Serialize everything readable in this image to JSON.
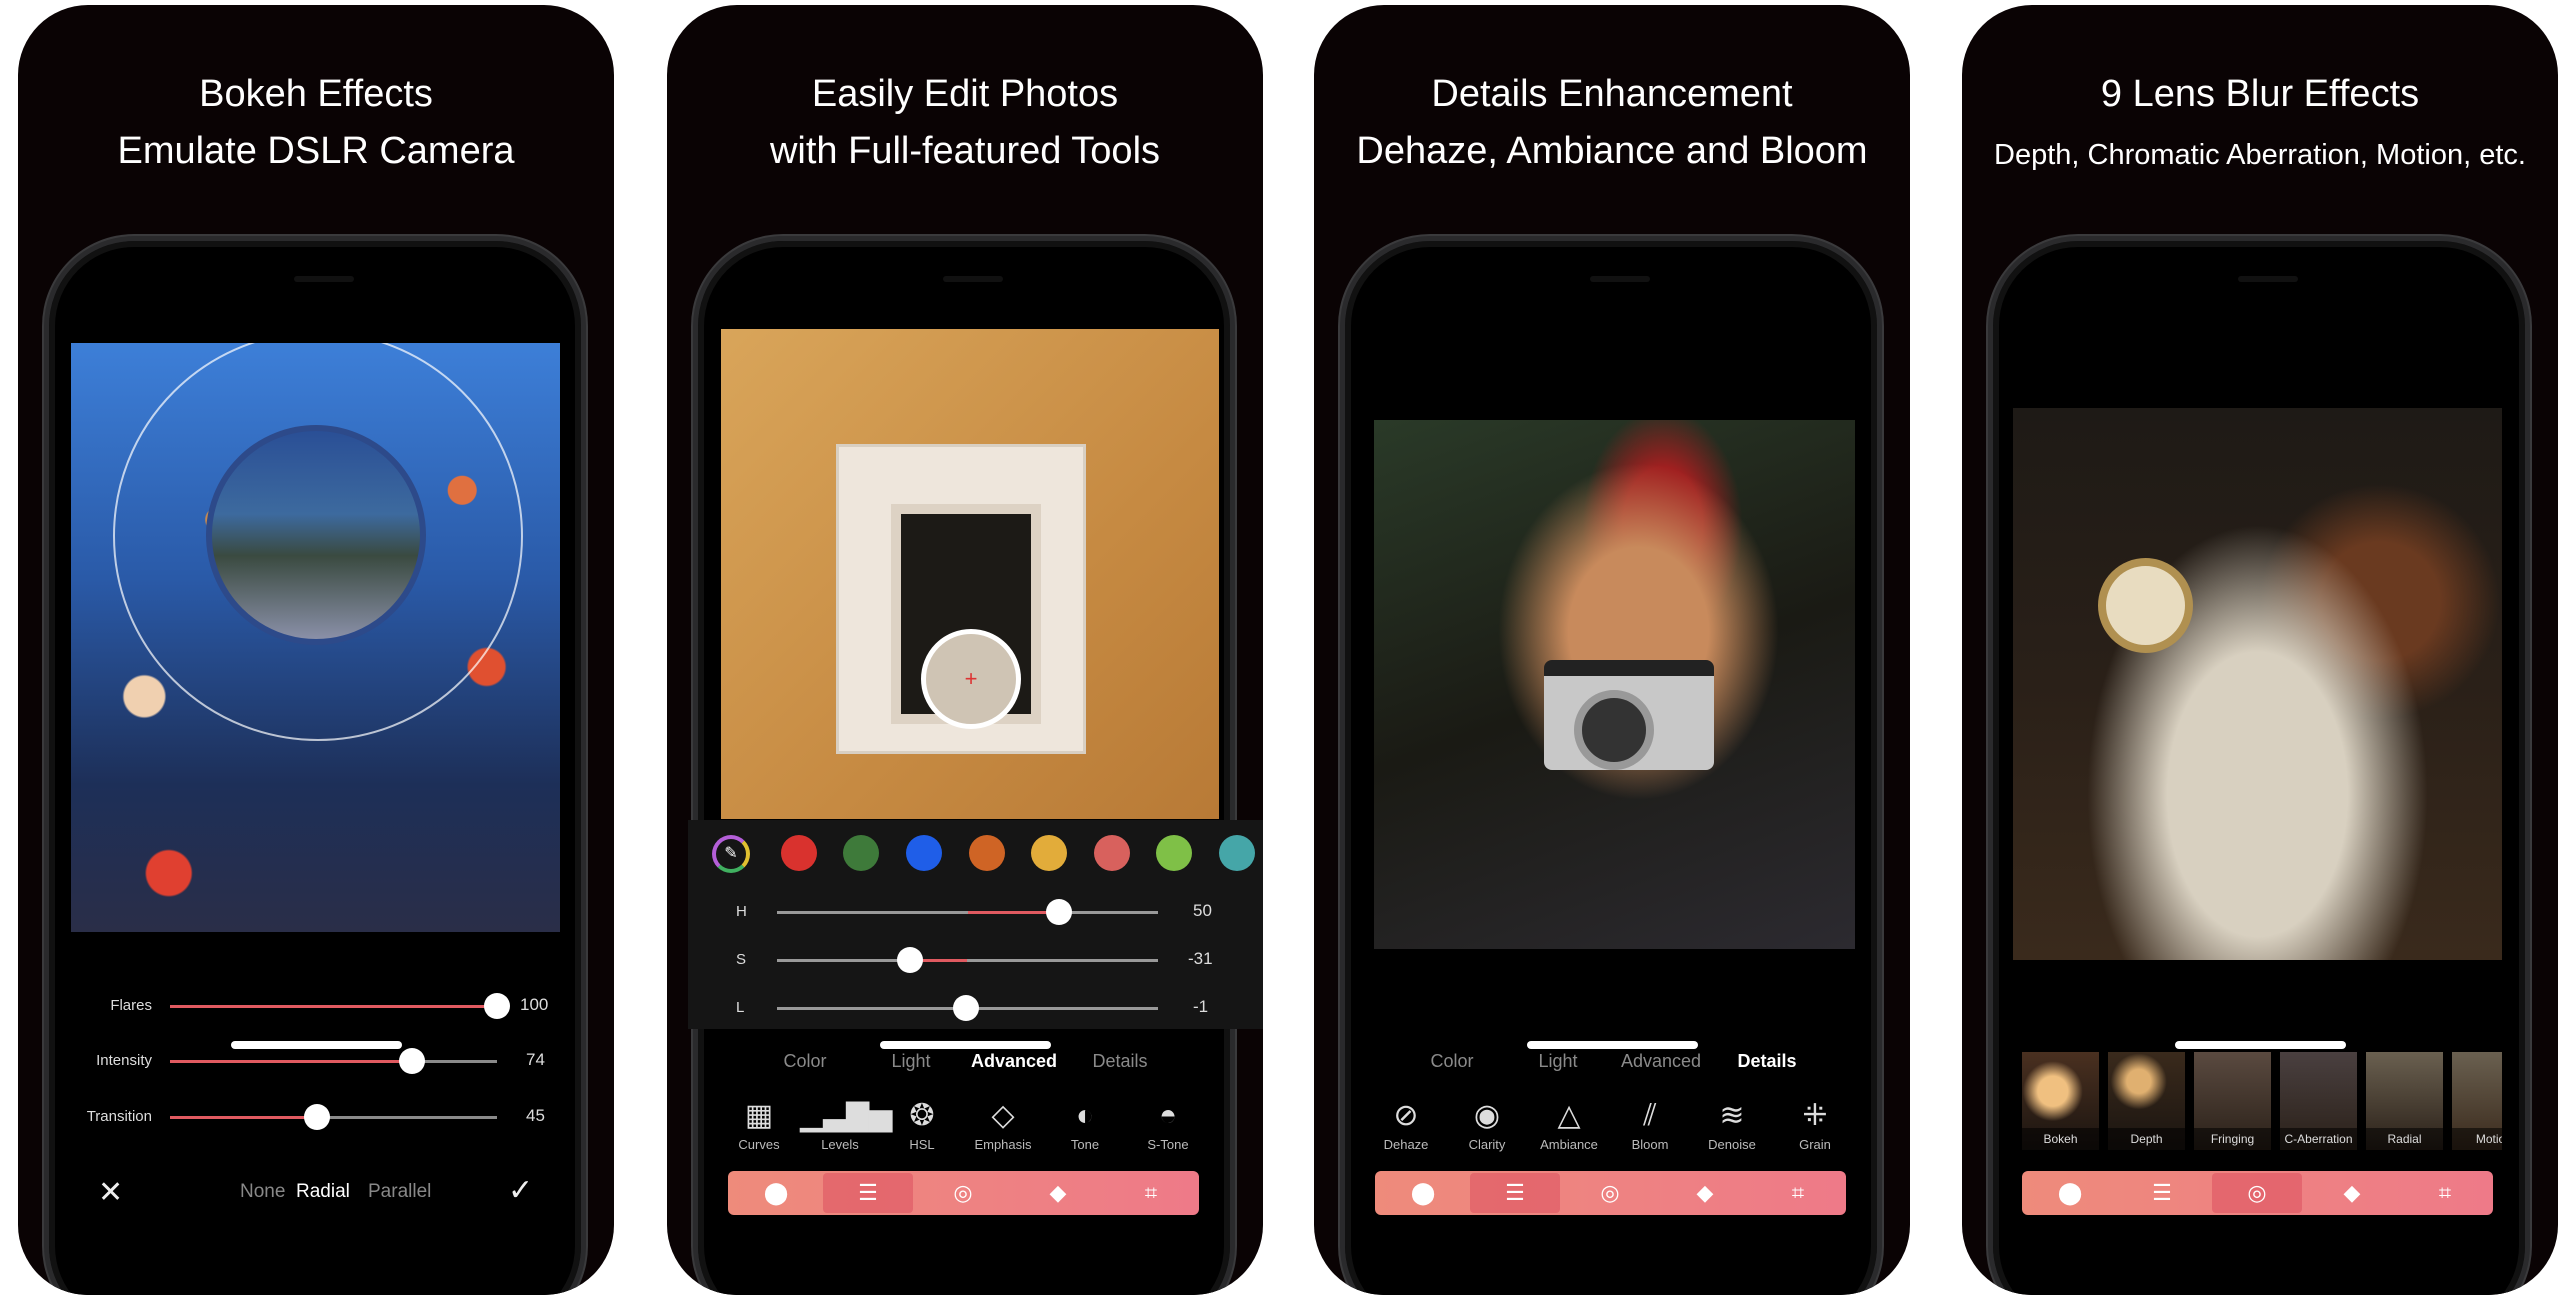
{
  "accent_color": "#e05a60",
  "toolbar_gradient": [
    "#ee8b7b",
    "#ee7a88"
  ],
  "toolbar_icons": [
    "color-circles-icon",
    "sliders-icon",
    "aperture-icon",
    "layers-icon",
    "crop-icon"
  ],
  "panels": [
    {
      "title_line1": "Bokeh Effects",
      "title_line2": "Emulate DSLR Camera",
      "sliders": [
        {
          "label": "Flares",
          "value": "100",
          "fraction": 1.0
        },
        {
          "label": "Intensity",
          "value": "74",
          "fraction": 0.74
        },
        {
          "label": "Transition",
          "value": "45",
          "fraction": 0.45
        }
      ],
      "modes": [
        "None",
        "Radial",
        "Parallel"
      ],
      "selected_mode": "Radial"
    },
    {
      "title_line1": "Easily Edit Photos",
      "title_line2": "with Full-featured Tools",
      "swatches": [
        "#d9322e",
        "#3e7a3a",
        "#1f5ee8",
        "#cf6425",
        "#e2ac3a",
        "#d8615d",
        "#7fc047",
        "#45a6a8"
      ],
      "hsl": [
        {
          "label": "H",
          "value": "50"
        },
        {
          "label": "S",
          "value": "-31"
        },
        {
          "label": "L",
          "value": "-1"
        }
      ],
      "tabs": [
        "Color",
        "Light",
        "Advanced",
        "Details"
      ],
      "selected_tab": "Advanced",
      "tools": [
        "Curves",
        "Levels",
        "HSL",
        "Emphasis",
        "Tone",
        "S-Tone"
      ],
      "selected_toolbar": "sliders-icon"
    },
    {
      "title_line1": "Details Enhancement",
      "title_line2": "Dehaze, Ambiance and Bloom",
      "tabs": [
        "Color",
        "Light",
        "Advanced",
        "Details"
      ],
      "selected_tab": "Details",
      "tools": [
        "Dehaze",
        "Clarity",
        "Ambiance",
        "Bloom",
        "Denoise",
        "Grain"
      ],
      "selected_toolbar": "sliders-icon"
    },
    {
      "title_line1": "9 Lens Blur Effects",
      "title_line2": "Depth, Chromatic Aberration, Motion, etc.",
      "effects": [
        "Bokeh",
        "Depth",
        "Fringing",
        "C-Aberration",
        "Radial",
        "Motio"
      ],
      "selected_toolbar": "aperture-icon"
    }
  ]
}
